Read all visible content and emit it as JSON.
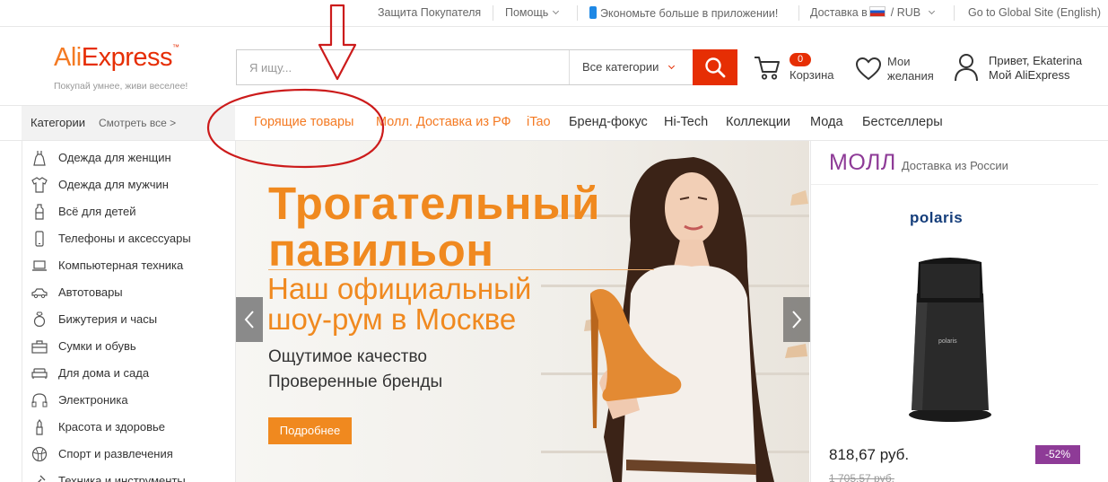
{
  "topbar": {
    "buyer_protection": "Защита Покупателя",
    "help": "Помощь",
    "app": "Экономьте больше в приложении!",
    "delivery": "Доставка в",
    "currency": "/  RUB",
    "global": "Go to Global Site (English)"
  },
  "header": {
    "logo_ali": "Ali",
    "logo_express": "Express",
    "logo_tm": "™",
    "slogan": "Покупай умнее, живи веселее!",
    "search": {
      "placeholder": "Я ищу...",
      "category": "Все категории"
    },
    "cart": {
      "count": "0",
      "label": "Корзина"
    },
    "wishlist": {
      "line1": "Мои",
      "line2": "желания"
    },
    "account": {
      "line1": "Привет, Ekaterina",
      "line2": "Мой AliExpress"
    }
  },
  "categories_header": {
    "title": "Категории",
    "see_all": "Смотреть все >"
  },
  "nav": [
    "Горящие товары",
    "Молл. Доставка из РФ",
    "iTao",
    "Бренд-фокус",
    "Hi-Tech",
    "Коллекции",
    "Мода",
    "Бестселлеры"
  ],
  "sidebar": {
    "items": [
      {
        "label": "Одежда для женщин",
        "icon": "dress-icon"
      },
      {
        "label": "Одежда для мужчин",
        "icon": "shirt-icon"
      },
      {
        "label": "Всё для детей",
        "icon": "baby-bottle-icon"
      },
      {
        "label": "Телефоны и аксессуары",
        "icon": "phone-icon"
      },
      {
        "label": "Компьютерная техника",
        "icon": "laptop-icon"
      },
      {
        "label": "Автотовары",
        "icon": "car-icon"
      },
      {
        "label": "Бижутерия и часы",
        "icon": "ring-icon"
      },
      {
        "label": "Сумки и обувь",
        "icon": "bag-icon"
      },
      {
        "label": "Для дома и сада",
        "icon": "sofa-icon"
      },
      {
        "label": "Электроника",
        "icon": "headphones-icon"
      },
      {
        "label": "Красота и здоровье",
        "icon": "lipstick-icon"
      },
      {
        "label": "Спорт и развлечения",
        "icon": "ball-icon"
      },
      {
        "label": "Техника и инструменты",
        "icon": "tools-icon"
      }
    ]
  },
  "banner": {
    "title1": "Трогательный",
    "title2": "павильон",
    "subtitle1": "Наш официальный",
    "subtitle2": "шоу-рум в Москве",
    "feature1": "Ощутимое качество",
    "feature2": "Проверенные бренды",
    "button": "Подробнее"
  },
  "mall": {
    "title": "МОЛЛ",
    "subtitle": "Доставка из России",
    "brand": "polaris",
    "product_logo": "polaris",
    "price": "818,67 руб.",
    "discount": "-52%",
    "old_price": "1 705,57 руб."
  },
  "colors": {
    "accent": "#e62e04",
    "orange": "#f0891f",
    "mall": "#8e3b97",
    "annotation": "#cc1b1b"
  }
}
